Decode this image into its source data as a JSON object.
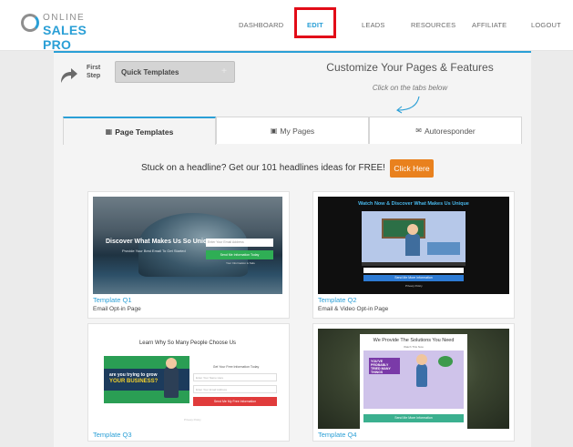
{
  "nav": {
    "logo_line1": "ONLINE",
    "logo_line2": "SALES PRO",
    "items": [
      {
        "label": "DASHBOARD"
      },
      {
        "label": "EDIT"
      },
      {
        "label": "LEADS"
      },
      {
        "label": "RESOURCES"
      },
      {
        "label": "AFFILIATE"
      },
      {
        "label": "LOGOUT"
      }
    ],
    "active": "EDIT",
    "highlight_color": "#e20c18"
  },
  "step": {
    "label": "First Step",
    "button_label": "Quick Templates",
    "button_icon": "+"
  },
  "intro": {
    "heading": "Customize Your Pages & Features",
    "hint": "Click on the tabs below"
  },
  "tabs": [
    {
      "label": "Page Templates",
      "icon": "document-icon"
    },
    {
      "label": "My Pages",
      "icon": "save-icon"
    },
    {
      "label": "Autoresponder",
      "icon": "envelope-icon"
    }
  ],
  "banner": {
    "text": "Stuck on a headline? Get our 101 headlines ideas for FREE!",
    "button": "Click Here",
    "button_color": "#e9811e"
  },
  "templates": [
    {
      "title": "Template Q1",
      "subtitle": "Email Opt-in Page",
      "preview": {
        "headline": "Discover What Makes Us So Unique",
        "subhead": "Provide Your Best Email To Get Started",
        "input_placeholder": "Enter Your Email Address",
        "button": "Send Me Information Today",
        "fine_print": "Your Information is Safe"
      }
    },
    {
      "title": "Template Q2",
      "subtitle": "Email & Video Opt-in Page",
      "preview": {
        "headline": "Watch Now & Discover What Makes Us Unique",
        "button": "Send Me More Information",
        "fine_print": "Privacy Policy"
      }
    },
    {
      "title": "Template Q3",
      "subtitle": "",
      "preview": {
        "headline": "Learn Why So Many People Choose Us",
        "image_line1": "are you trying to grow",
        "image_line2": "YOUR BUSINESS?",
        "form_title": "Get Your Free Information Today",
        "input1_placeholder": "Enter Your Name Here",
        "input2_placeholder": "Enter Your Email Address",
        "button": "Send Me My Free Information",
        "fine_print": "Privacy Policy"
      }
    },
    {
      "title": "Template Q4",
      "subtitle": "",
      "preview": {
        "headline": "We Provide The Solutions You Need",
        "subhead": "Watch This Now",
        "sign_text": "YOU'VE PROBABLY TRIED MANY THINGS",
        "button": "Send Me More Information"
      }
    }
  ],
  "colors": {
    "accent": "#2a9fd6",
    "green": "#2fae55",
    "red": "#e03b3b"
  }
}
